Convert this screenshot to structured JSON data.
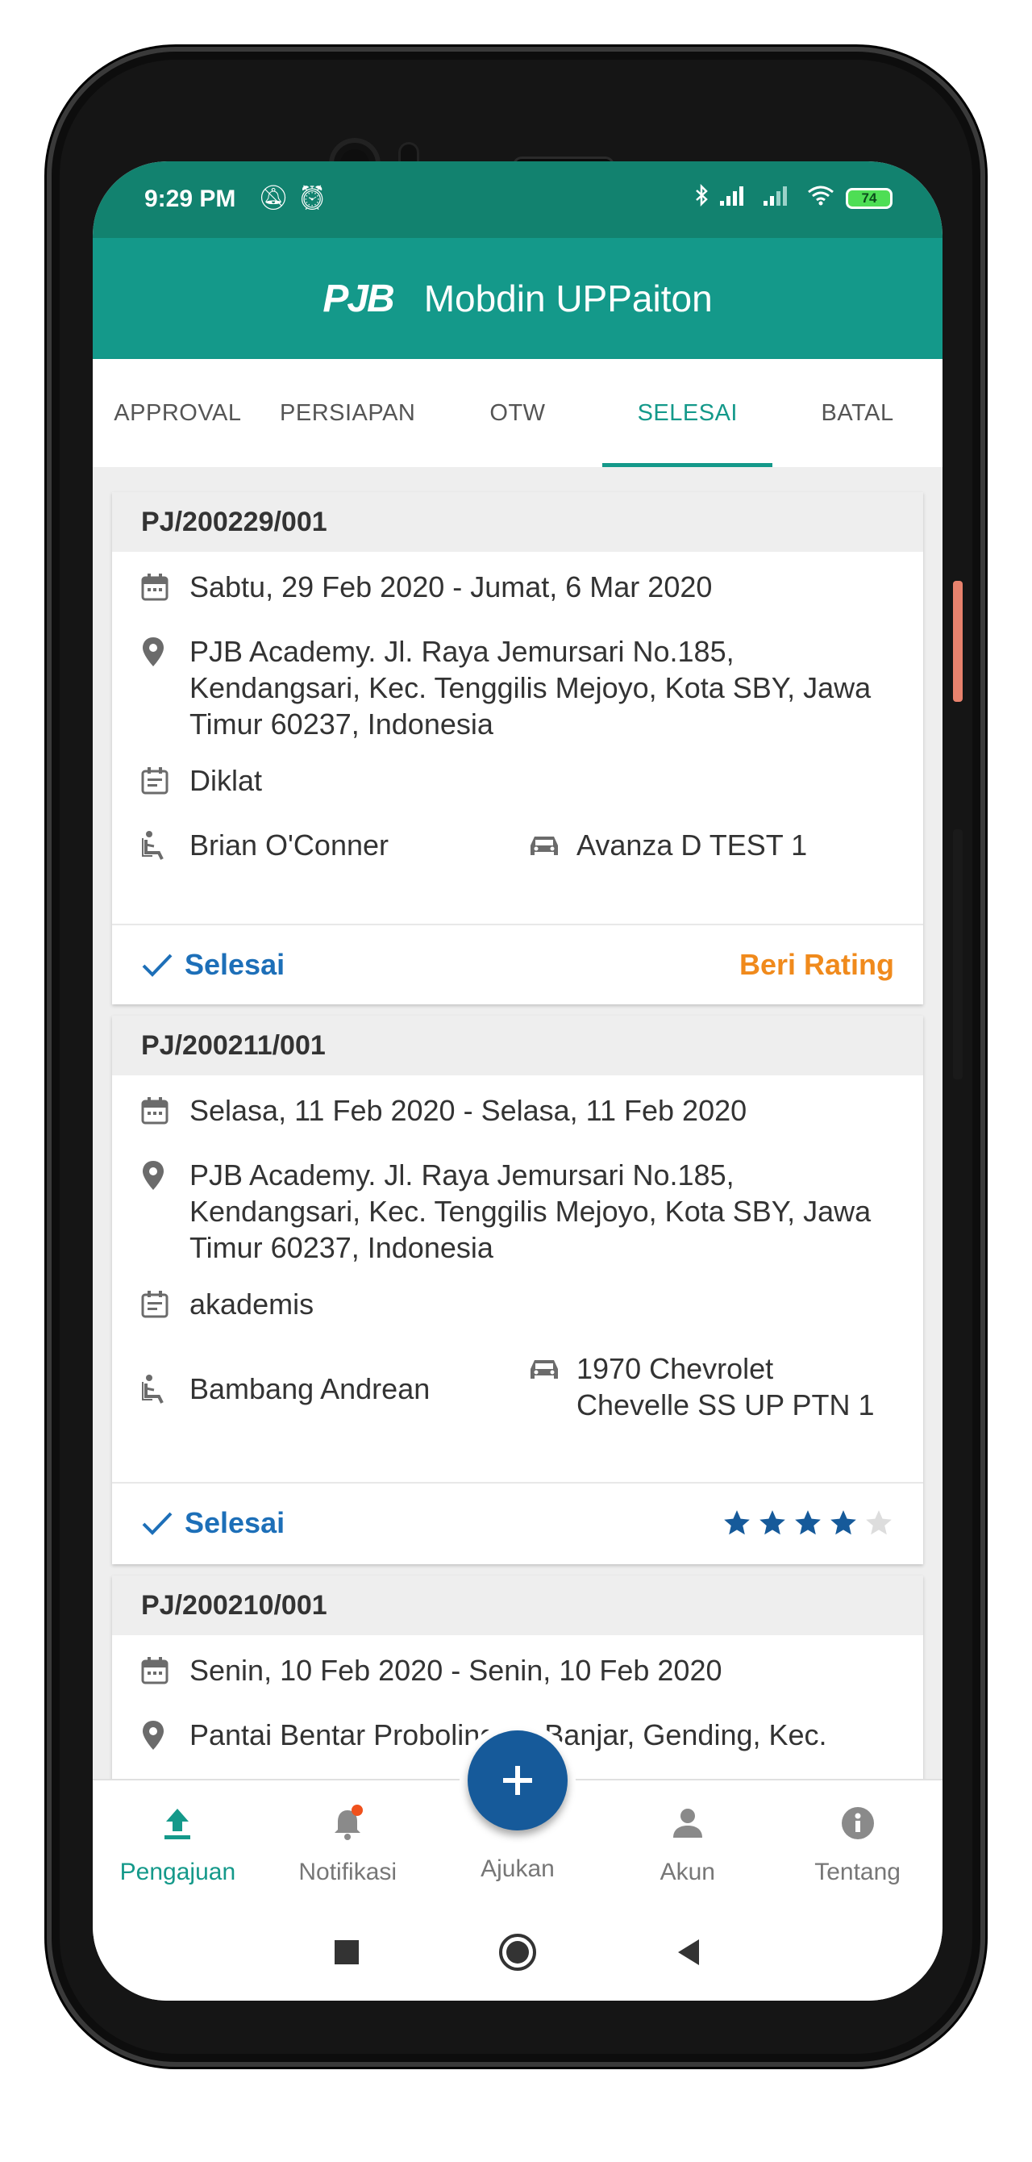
{
  "status_bar": {
    "time": "9:29 PM",
    "battery": "74"
  },
  "app_bar": {
    "logo": "PJB",
    "title": "Mobdin UPPaiton"
  },
  "tabs": [
    {
      "label": "APPROVAL",
      "active": false
    },
    {
      "label": "PERSIAPAN",
      "active": false
    },
    {
      "label": "OTW",
      "active": false
    },
    {
      "label": "SELESAI",
      "active": true
    },
    {
      "label": "BATAL",
      "active": false
    }
  ],
  "cards": [
    {
      "id": "PJ/200229/001",
      "date": "Sabtu, 29 Feb 2020 - Jumat, 6 Mar 2020",
      "location": "PJB Academy. Jl. Raya Jemursari No.185, Kendangsari, Kec. Tenggilis Mejoyo, Kota SBY, Jawa Timur 60237, Indonesia",
      "purpose": "Diklat",
      "driver": "Brian O'Conner",
      "vehicle": "Avanza D TEST 1",
      "status": "Selesai",
      "rating_action": "Beri Rating"
    },
    {
      "id": "PJ/200211/001",
      "date": "Selasa, 11 Feb 2020 - Selasa, 11 Feb 2020",
      "location": "PJB Academy. Jl. Raya Jemursari No.185, Kendangsari, Kec. Tenggilis Mejoyo, Kota SBY, Jawa Timur 60237, Indonesia",
      "purpose": "akademis",
      "driver": "Bambang Andrean",
      "vehicle_line1": "1970 Chevrolet",
      "vehicle_line2": "Chevelle SS UP PTN 1",
      "status": "Selesai",
      "rating": 4,
      "rating_max": 5
    },
    {
      "id": "PJ/200210/001",
      "date": "Senin, 10 Feb 2020 - Senin, 10 Feb 2020",
      "location": "Pantai Bentar Probolinggo, Banjar, Gending, Kec."
    }
  ],
  "bottom_nav": [
    {
      "label": "Pengajuan",
      "icon": "upload-icon",
      "active": true
    },
    {
      "label": "Notifikasi",
      "icon": "bell-icon",
      "active": false
    },
    {
      "label": "Ajukan",
      "icon": "add-icon",
      "active": false
    },
    {
      "label": "Akun",
      "icon": "person-icon",
      "active": false
    },
    {
      "label": "Tentang",
      "icon": "info-icon",
      "active": false
    }
  ],
  "colors": {
    "primary": "#14998a",
    "status_bar": "#12826f",
    "fab": "#165a9a",
    "done": "#1d6fb8",
    "rating_link": "#f08a1c",
    "star": "#165a9a"
  }
}
